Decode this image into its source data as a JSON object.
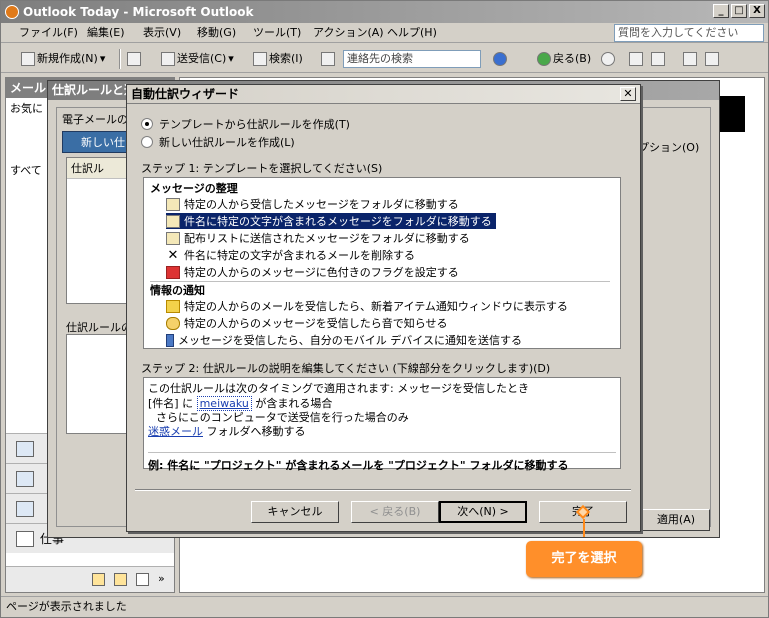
{
  "window": {
    "title": "Outlook Today - Microsoft Outlook",
    "min_label": "_",
    "max_label": "□",
    "close_label": "X"
  },
  "menu": {
    "items": [
      "ファイル(F)",
      "編集(E)",
      "表示(V)",
      "移動(G)",
      "ツール(T)",
      "アクション(A)",
      "ヘルプ(H)"
    ],
    "help_placeholder": "質問を入力してください"
  },
  "toolbar": {
    "new_label": "新規作成(N)",
    "sendrecv_label": "送受信(C)",
    "search_label": "検索(I)",
    "contact_placeholder": "連絡先の検索",
    "back_label": "戻る(B)"
  },
  "nav": {
    "header": "メール",
    "favorites_label": "お気に",
    "all_label": "すべて",
    "tasks_label": "仕事"
  },
  "rules_dialog": {
    "title": "仕訳ルールと通",
    "tab_label": "電子メールの",
    "new_rule_label": "新しい仕",
    "list_header": "仕訳ル",
    "desc_label": "仕訳ルールの",
    "options_label": "プション(O)",
    "apply_label": "適用(A)"
  },
  "wizard": {
    "title": "自動仕訳ウィザード",
    "radio_template": "テンプレートから仕訳ルールを作成(T)",
    "radio_blank": "新しい仕訳ルールを作成(L)",
    "step1_label": "ステップ 1: テンプレートを選択してください(S)",
    "group1": "メッセージの整理",
    "items1": [
      "特定の人から受信したメッセージをフォルダに移動する",
      "件名に特定の文字が含まれるメッセージをフォルダに移動する",
      "配布リストに送信されたメッセージをフォルダに移動する",
      "件名に特定の文字が含まれるメールを削除する",
      "特定の人からのメッセージに色付きのフラグを設定する"
    ],
    "group2": "情報の通知",
    "items2": [
      "特定の人からのメールを受信したら、新着アイテム通知ウィンドウに表示する",
      "特定の人からのメッセージを受信したら音で知らせる",
      "メッセージを受信したら、自分のモバイル デバイスに通知を送信する"
    ],
    "step2_label": "ステップ 2: 仕訳ルールの説明を編集してください (下線部分をクリックします)(D)",
    "desc_line1": "この仕訳ルールは次のタイミングで適用されます: メッセージを受信したとき",
    "desc_line2_pre": "[件名] に",
    "desc_line2_link": "meiwaku",
    "desc_line2_post": "が含まれる場合",
    "desc_line3": "さらにこのコンピュータで送受信を行った場合のみ",
    "desc_line4_link": "迷惑メール",
    "desc_line4_post": "フォルダへ移動する",
    "example": "例: 件名に \"プロジェクト\" が含まれるメールを \"プロジェクト\" フォルダに移動する",
    "cancel_label": "キャンセル",
    "back_label": "< 戻る(B)",
    "next_label": "次へ(N) >",
    "finish_label": "完了"
  },
  "callout": "完了を選択",
  "statusbar": "ページが表示されました"
}
